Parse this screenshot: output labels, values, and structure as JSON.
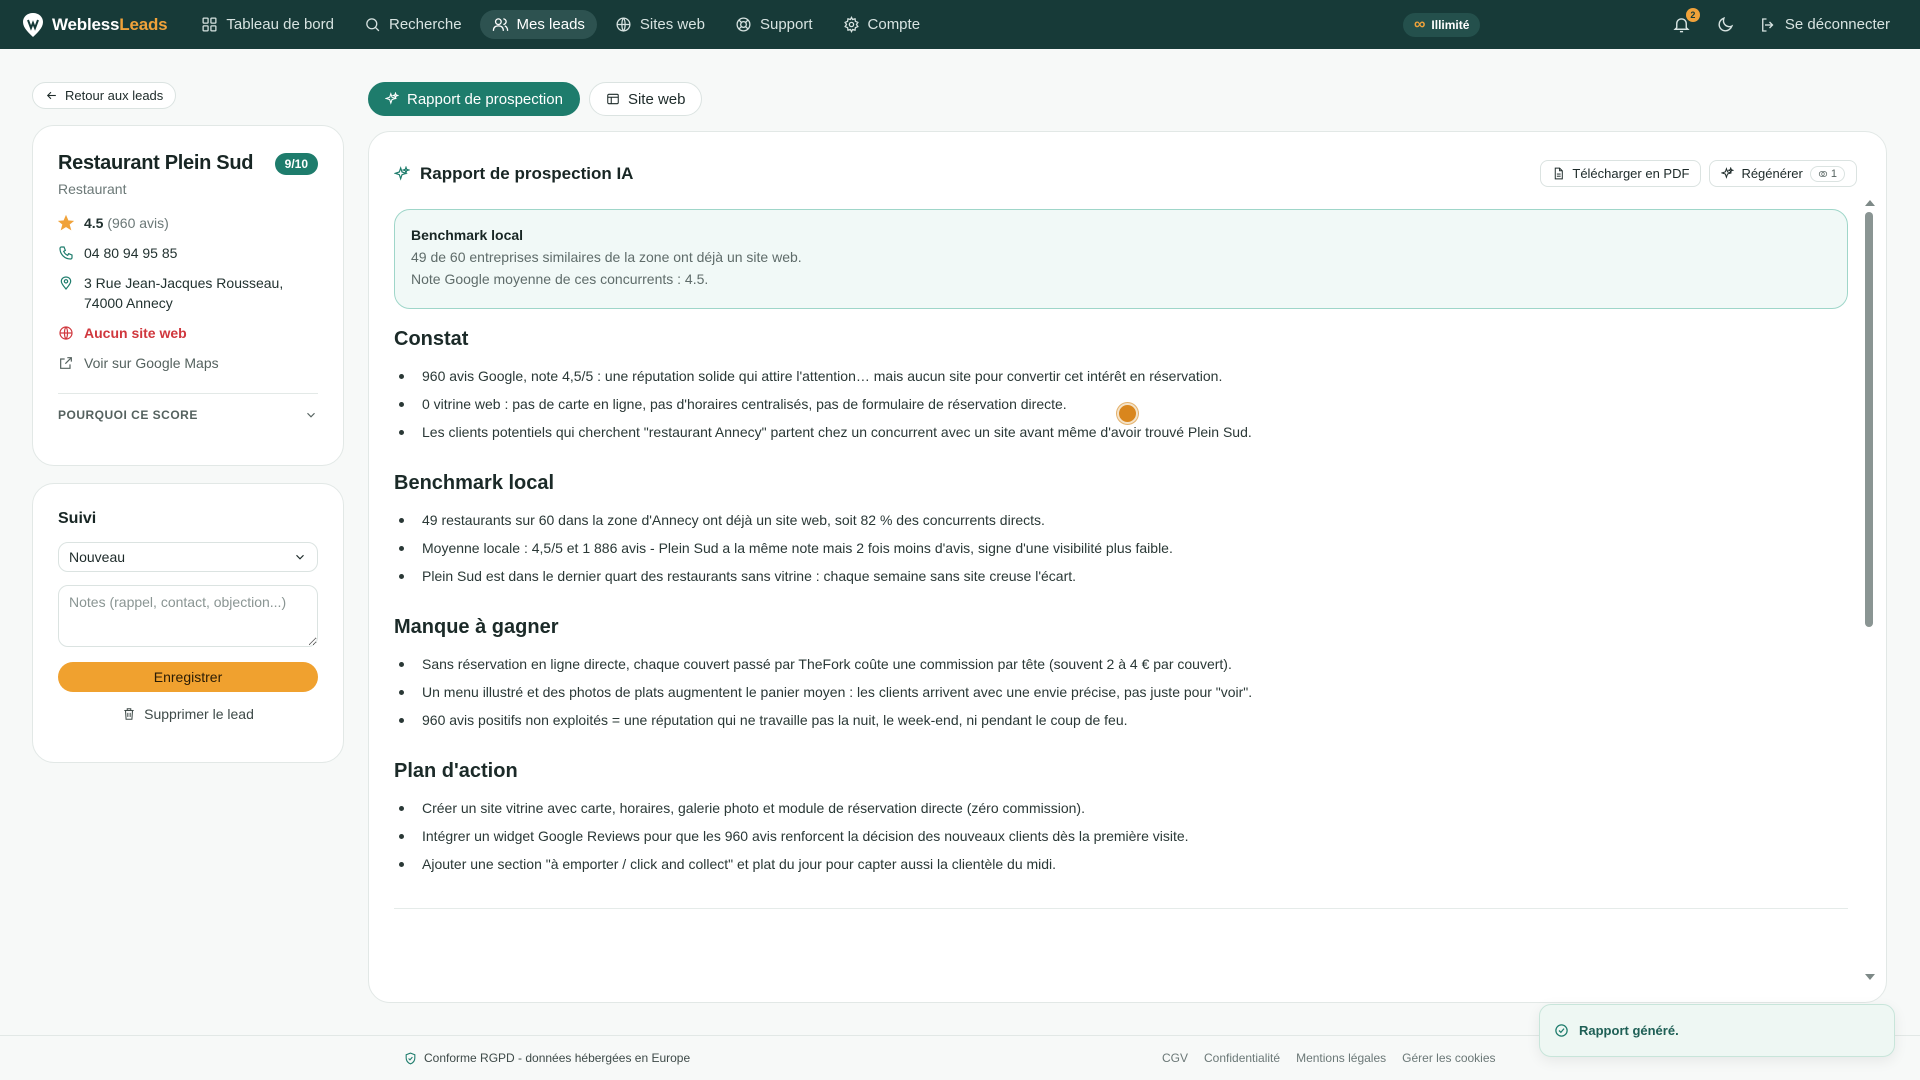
{
  "brand": {
    "name_main": "Webless",
    "name_accent": "Leads",
    "accent_color": "#f0a23a",
    "bar_color": "#173a38"
  },
  "nav": [
    {
      "label": "Tableau de bord",
      "icon": "dashboard-icon"
    },
    {
      "label": "Recherche",
      "icon": "search-icon"
    },
    {
      "label": "Mes leads",
      "icon": "users-icon",
      "active": true
    },
    {
      "label": "Sites web",
      "icon": "globe-icon"
    },
    {
      "label": "Support",
      "icon": "support-icon"
    },
    {
      "label": "Compte",
      "icon": "gear-icon"
    }
  ],
  "plan": {
    "label": "Illimité",
    "icon": "infinity-icon"
  },
  "notifications": {
    "count": "2"
  },
  "logout_label": "Se déconnecter",
  "back_label": "Retour aux leads",
  "lead": {
    "name": "Restaurant Plein Sud",
    "score": "9/10",
    "category": "Restaurant",
    "rating": "4.5",
    "reviews": "(960 avis)",
    "phone": "04 80 94 95 85",
    "address_line1": "3 Rue Jean-Jacques Rousseau,",
    "address_line2": "74000 Annecy",
    "website_status": "Aucun site web",
    "maps_link": "Voir sur Google Maps",
    "why_score": "POURQUOI CE SCORE"
  },
  "suivi": {
    "title": "Suivi",
    "status": "Nouveau",
    "notes_placeholder": "Notes (rappel, contact, objection...)",
    "save_label": "Enregistrer",
    "delete_label": "Supprimer le lead"
  },
  "tabs": [
    {
      "label": "Rapport de prospection",
      "active": true
    },
    {
      "label": "Site web",
      "active": false
    }
  ],
  "report": {
    "title": "Rapport de prospection IA",
    "download_label": "Télécharger en PDF",
    "regenerate_label": "Régénérer",
    "regenerate_credits": "1",
    "benchmark_box": {
      "title": "Benchmark local",
      "line1": "49 de 60 entreprises similaires de la zone ont déjà un site web.",
      "line2": "Note Google moyenne de ces concurrents : 4.5."
    },
    "sections": [
      {
        "heading": "Constat",
        "bullets": [
          "960 avis Google, note 4,5/5 : une réputation solide qui attire l'attention… mais aucun site pour convertir cet intérêt en réservation.",
          "0 vitrine web : pas de carte en ligne, pas d'horaires centralisés, pas de formulaire de réservation directe.",
          "Les clients potentiels qui cherchent \"restaurant Annecy\" partent chez un concurrent avec un site avant même d'avoir trouvé Plein Sud."
        ]
      },
      {
        "heading": "Benchmark local",
        "bullets": [
          "49 restaurants sur 60 dans la zone d'Annecy ont déjà un site web, soit 82 % des concurrents directs.",
          "Moyenne locale : 4,5/5 et 1 886 avis - Plein Sud a la même note mais 2 fois moins d'avis, signe d'une visibilité plus faible.",
          "Plein Sud est dans le dernier quart des restaurants sans vitrine : chaque semaine sans site creuse l'écart."
        ]
      },
      {
        "heading": "Manque à gagner",
        "bullets": [
          "Sans réservation en ligne directe, chaque couvert passé par TheFork coûte une commission par tête (souvent 2 à 4 € par couvert).",
          "Un menu illustré et des photos de plats augmentent le panier moyen : les clients arrivent avec une envie précise, pas juste pour \"voir\".",
          "960 avis positifs non exploités = une réputation qui ne travaille pas la nuit, le week-end, ni pendant le coup de feu."
        ]
      },
      {
        "heading": "Plan d'action",
        "bullets": [
          "Créer un site vitrine avec carte, horaires, galerie photo et module de réservation directe (zéro commission).",
          "Intégrer un widget Google Reviews pour que les 960 avis renforcent la décision des nouveaux clients dès la première visite.",
          "Ajouter une section \"à emporter / click and collect\" et plat du jour pour capter aussi la clientèle du midi."
        ]
      }
    ]
  },
  "footer": {
    "rgpd": "Conforme RGPD - données hébergées en Europe",
    "links": [
      "CGV",
      "Confidentialité",
      "Mentions légales",
      "Gérer les cookies"
    ]
  },
  "toast": {
    "message": "Rapport généré."
  }
}
